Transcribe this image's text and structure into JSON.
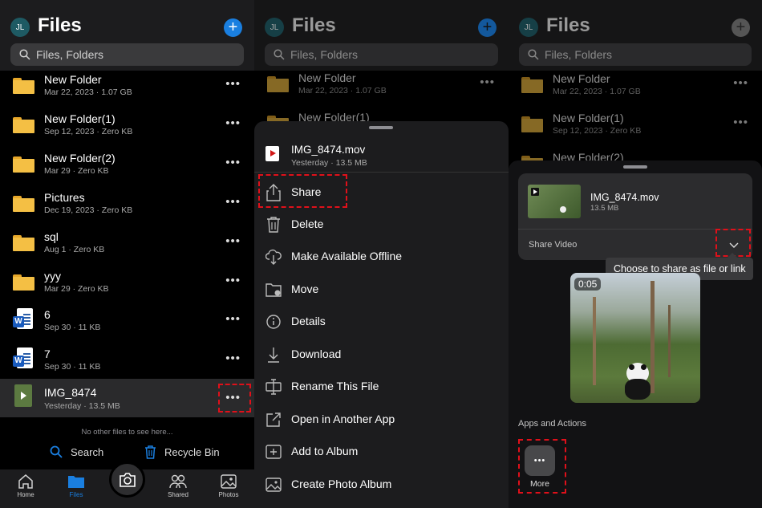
{
  "header": {
    "avatar": "JL",
    "title": "Files",
    "search_placeholder": "Files, Folders",
    "add": "+"
  },
  "files": [
    {
      "name": "New Folder",
      "meta": "Mar 22, 2023 · 1.07 GB",
      "kind": "folder"
    },
    {
      "name": "New Folder(1)",
      "meta": "Sep 12, 2023 · Zero KB",
      "kind": "folder"
    },
    {
      "name": "New Folder(2)",
      "meta": "Mar 29 · Zero KB",
      "kind": "folder"
    },
    {
      "name": "Pictures",
      "meta": "Dec 19, 2023 · Zero KB",
      "kind": "folder"
    },
    {
      "name": "sql",
      "meta": "Aug 1 · Zero KB",
      "kind": "folder"
    },
    {
      "name": "yyy",
      "meta": "Mar 29 · Zero KB",
      "kind": "folder"
    },
    {
      "name": "6",
      "meta": "Sep 30 · 11 KB",
      "kind": "word"
    },
    {
      "name": "7",
      "meta": "Sep 30 · 11 KB",
      "kind": "word"
    },
    {
      "name": "IMG_8474",
      "meta": "Yesterday · 13.5 MB",
      "kind": "video"
    }
  ],
  "more_glyph": "•••",
  "footer": {
    "empty_note": "No other files to see here...",
    "search": "Search",
    "recycle": "Recycle Bin"
  },
  "tabs": [
    {
      "label": "Home",
      "icon": "home-icon"
    },
    {
      "label": "Files",
      "icon": "folder-icon",
      "active": true
    },
    {
      "label": "Shared",
      "icon": "people-icon"
    },
    {
      "label": "Photos",
      "icon": "photo-icon"
    }
  ],
  "sheet": {
    "file_name": "IMG_8474.mov",
    "file_meta": "Yesterday · 13.5 MB",
    "items": [
      "Share",
      "Delete",
      "Make Available Offline",
      "Move",
      "Details",
      "Download",
      "Rename This File",
      "Open in Another App",
      "Add to Album",
      "Create Photo Album"
    ]
  },
  "share": {
    "file_name": "IMG_8474.mov",
    "file_size": "13.5 MB",
    "share_label": "Share Video",
    "tooltip": "Choose to share as file or link",
    "duration": "0:05",
    "apps_label": "Apps and Actions",
    "more_label": "More"
  },
  "colors": {
    "accent": "#1a7fe0",
    "folder": "#f4bf44",
    "highlight": "#e0101a",
    "sheet": "#1c1c1e"
  }
}
